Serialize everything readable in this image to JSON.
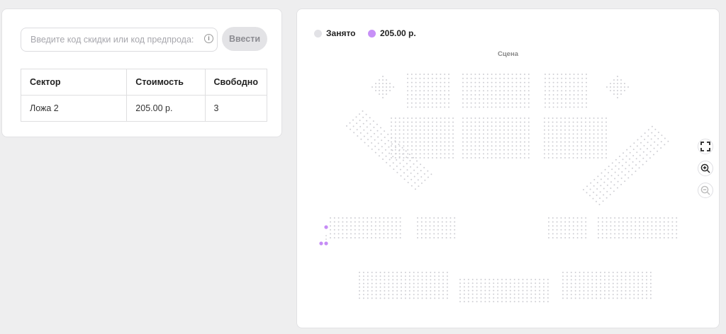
{
  "promo": {
    "placeholder": "Введите код скидки или код предпрода:",
    "apply_label": "Ввести",
    "info_glyph": "i"
  },
  "table": {
    "headers": [
      "Сектор",
      "Стоимость",
      "Свободно"
    ],
    "rows": [
      [
        "Ложа 2",
        "205.00 р.",
        "3"
      ]
    ]
  },
  "legend": [
    {
      "label": "Занято",
      "color": "#e2e2e6"
    },
    {
      "label": "205.00 р.",
      "color": "#c790f7"
    }
  ],
  "map": {
    "scene_label": "Сцена",
    "occupied_color": "#cfcfd4",
    "available_color": "#c68cf5"
  },
  "controls": {
    "fullscreen_icon": "fullscreen-icon",
    "zoom_in_icon": "zoom-in-icon",
    "zoom_out_icon": "zoom-out-icon"
  }
}
